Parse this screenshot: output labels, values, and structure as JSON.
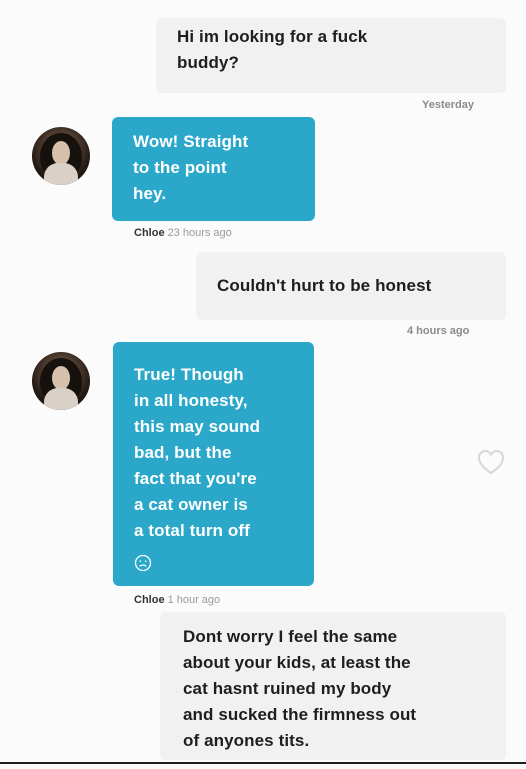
{
  "conversation": {
    "messages": [
      {
        "direction": "outgoing",
        "text": "Hi im looking for a fuck\nbuddy?",
        "timestamp": "Yesterday"
      },
      {
        "direction": "incoming",
        "sender": "Chloe",
        "text": "Wow! Straight\nto the point\nhey.",
        "timestamp": "23 hours ago"
      },
      {
        "direction": "outgoing",
        "text": "Couldn't hurt to be honest",
        "timestamp": "4 hours ago"
      },
      {
        "direction": "incoming",
        "sender": "Chloe",
        "text": "True! Though\nin all honesty,\nthis may sound\nbad, but the\nfact that you're\na cat owner is\na total turn off",
        "timestamp": "1 hour ago"
      },
      {
        "direction": "outgoing",
        "text": "Dont worry I feel the same\nabout your kids, at least the\ncat hasnt ruined my body\nand sucked the firmness out\nof anyones tits."
      }
    ]
  },
  "colors": {
    "incoming_bubble": "#2aa7c9",
    "outgoing_bubble": "#f1f1f1",
    "text_dark": "#1e1e1e",
    "text_light": "#ffffff",
    "timestamp": "#8a8a8a"
  },
  "icons": {
    "avatar": "avatar-icon",
    "emoji": "emoji-icon",
    "heart": "heart-icon"
  }
}
